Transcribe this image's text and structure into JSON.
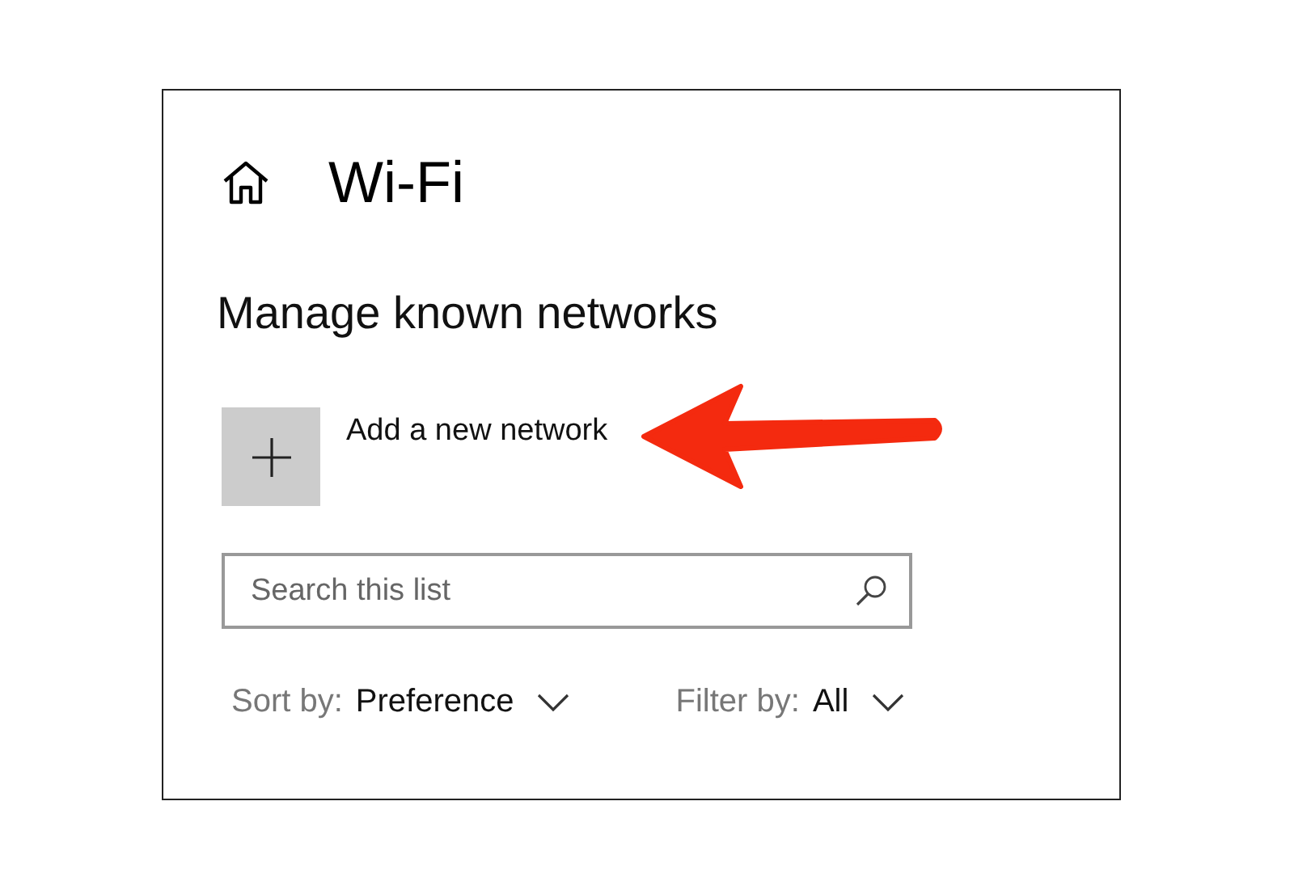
{
  "title": "Wi-Fi",
  "heading": "Manage known networks",
  "add_network": {
    "label": "Add a new network"
  },
  "search": {
    "placeholder": "Search this list"
  },
  "sort": {
    "label": "Sort by:",
    "value": "Preference"
  },
  "filter": {
    "label": "Filter by:",
    "value": "All"
  },
  "annotation": {
    "kind": "arrow"
  }
}
